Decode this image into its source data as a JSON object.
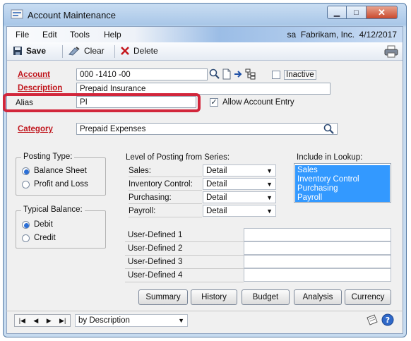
{
  "window": {
    "title": "Account Maintenance"
  },
  "menu": {
    "items": [
      "File",
      "Edit",
      "Tools",
      "Help"
    ],
    "user": "sa",
    "company": "Fabrikam, Inc.",
    "date": "4/12/2017"
  },
  "toolbar": {
    "save": "Save",
    "clear": "Clear",
    "delete": "Delete"
  },
  "form": {
    "account_label": "Account",
    "account_value": "000 -1410 -00",
    "inactive_label": "Inactive",
    "description_label": "Description",
    "description_value": "Prepaid Insurance",
    "alias_label": "Alias",
    "alias_value": "PI",
    "allow_entry_label": "Allow Account Entry",
    "category_label": "Category",
    "category_value": "Prepaid Expenses"
  },
  "posting_type": {
    "title": "Posting Type:",
    "options": [
      "Balance Sheet",
      "Profit and Loss"
    ],
    "selected": 0
  },
  "typical_balance": {
    "title": "Typical Balance:",
    "options": [
      "Debit",
      "Credit"
    ],
    "selected": 0
  },
  "level_of_posting": {
    "title": "Level of Posting from Series:",
    "rows": [
      {
        "label": "Sales:",
        "value": "Detail"
      },
      {
        "label": "Inventory Control:",
        "value": "Detail"
      },
      {
        "label": "Purchasing:",
        "value": "Detail"
      },
      {
        "label": "Payroll:",
        "value": "Detail"
      }
    ]
  },
  "lookup": {
    "title": "Include in Lookup:",
    "items": [
      "Sales",
      "Inventory Control",
      "Purchasing",
      "Payroll"
    ]
  },
  "user_defined": {
    "labels": [
      "User-Defined 1",
      "User-Defined 2",
      "User-Defined 3",
      "User-Defined 4"
    ]
  },
  "actions": {
    "summary": "Summary",
    "history": "History",
    "budget": "Budget",
    "analysis": "Analysis",
    "currency": "Currency"
  },
  "footer": {
    "sort_value": "by Description"
  },
  "colors": {
    "required_label": "#c0161d",
    "selection": "#3399ff",
    "highlight_box": "#d2263b"
  }
}
